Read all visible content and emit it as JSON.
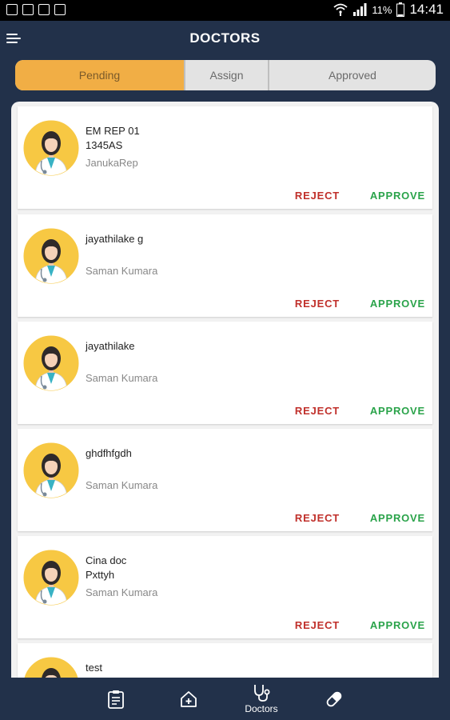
{
  "status_bar": {
    "battery_percent": "11%",
    "time": "14:41"
  },
  "header": {
    "title": "DOCTORS"
  },
  "tabs": [
    {
      "label": "Pending",
      "active": true
    },
    {
      "label": "Assign",
      "active": false
    },
    {
      "label": "Approved",
      "active": false
    }
  ],
  "doctors": [
    {
      "name": "EM REP 01",
      "code": "1345AS",
      "rep": "JanukaRep"
    },
    {
      "name": "jayathilake g",
      "code": "",
      "rep": "Saman Kumara"
    },
    {
      "name": "jayathilake",
      "code": "",
      "rep": "Saman Kumara"
    },
    {
      "name": "ghdfhfgdh",
      "code": "",
      "rep": "Saman Kumara"
    },
    {
      "name": "Cina doc",
      "code": "Pxttyh",
      "rep": "Saman Kumara"
    },
    {
      "name": "test",
      "code": "",
      "rep": ""
    }
  ],
  "actions": {
    "reject_label": "REJECT",
    "approve_label": "APPROVE"
  },
  "bottom_nav": {
    "doctors_label": "Doctors"
  },
  "colors": {
    "background": "#22314a",
    "active_tab": "#f1ae45",
    "reject": "#c0302b",
    "approve": "#2aa34a",
    "avatar_bg": "#f7c843"
  }
}
